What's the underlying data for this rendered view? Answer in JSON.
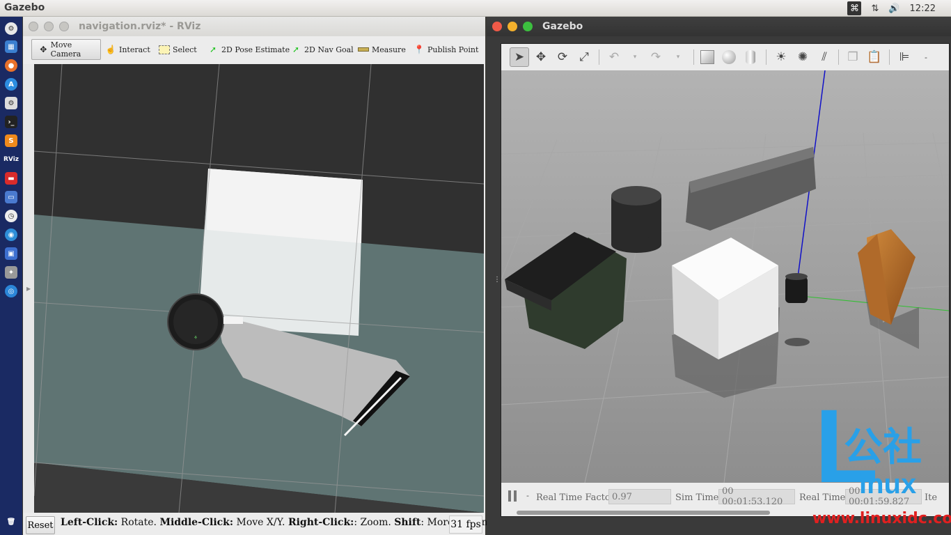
{
  "top_panel": {
    "app_name": "Gazebo",
    "clock": "12:22",
    "icons": [
      "keyboard-icon",
      "network-icon",
      "volume-icon",
      "apple-icon"
    ]
  },
  "launcher": {
    "icons": [
      "settings-icon",
      "files-icon",
      "firefox-icon",
      "appcenter-icon",
      "system-settings-icon",
      "terminal-icon",
      "sublime-icon",
      "rviz-icon",
      "screen-icon",
      "remote-desktop-icon",
      "clock-icon",
      "vpn-icon",
      "remote-icon",
      "gimp-icon",
      "browser-icon",
      "trash-icon"
    ],
    "rviz_label": "RViz"
  },
  "rviz": {
    "title": "navigation.rviz* - RViz",
    "tools": [
      {
        "label": "Move Camera",
        "icon": "move-camera-icon"
      },
      {
        "label": "Interact",
        "icon": "hand-icon"
      },
      {
        "label": "Select",
        "icon": "select-icon"
      },
      {
        "label": "2D Pose Estimate",
        "icon": "green-arrow-icon"
      },
      {
        "label": "2D Nav Goal",
        "icon": "green-arrow-icon"
      },
      {
        "label": "Measure",
        "icon": "ruler-icon"
      },
      {
        "label": "Publish Point",
        "icon": "pin-icon"
      }
    ],
    "status": {
      "reset": "Reset",
      "hint_parts": [
        {
          "b": "Left-Click:",
          "t": " Rotate. "
        },
        {
          "b": "Middle-Click:",
          "t": " Move X/Y. "
        },
        {
          "b": "Right-Click:",
          "t": ": Zoom. "
        },
        {
          "b": "Shift",
          "t": ": More options."
        }
      ],
      "fps": "31 fps"
    }
  },
  "gazebo": {
    "title": "Gazebo",
    "toolbar": [
      "select-arrow-icon",
      "translate-icon",
      "rotate-icon",
      "scale-icon",
      "undo-icon",
      "dropdown-icon",
      "redo-icon",
      "dropdown-icon",
      "box-icon",
      "sphere-icon",
      "cylinder-icon",
      "sun-light-icon",
      "spot-light-icon",
      "directional-light-icon",
      "copy-icon",
      "paste-icon",
      "align-icon",
      "more-icon"
    ],
    "status": {
      "rtf_label": "Real Time Factor:",
      "rtf_value": "0.97",
      "sim_label": "Sim Time:",
      "sim_value": "00 00:01:53.120",
      "real_label": "Real Time:",
      "real_value": "00 00:01:59.827",
      "iter_label": "Ite"
    }
  },
  "watermark": {
    "letter": "L",
    "chinese": "公社",
    "word": "inux",
    "url": "www.linuxidc.com",
    "color": "#29a0e8"
  }
}
